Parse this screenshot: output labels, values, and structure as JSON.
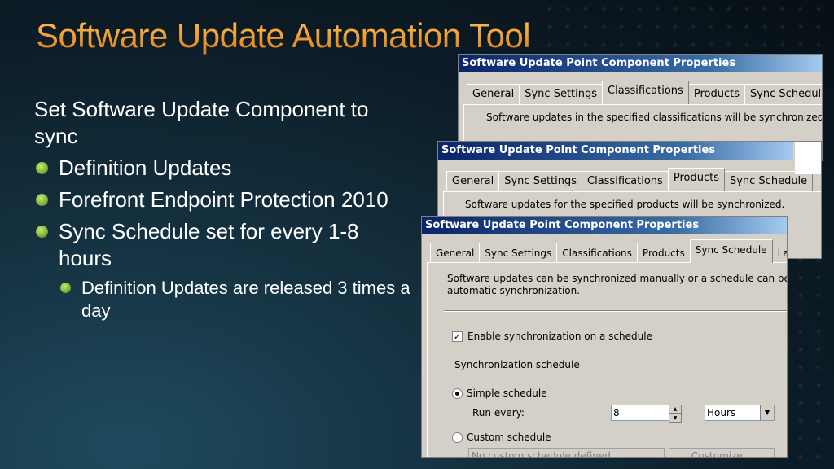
{
  "slide": {
    "title": "Software Update Automation Tool",
    "intro": "Set Software Update Component to sync",
    "bullets": [
      "Definition Updates",
      "Forefront Endpoint Protection 2010",
      "Sync Schedule set for every 1-8 hours"
    ],
    "sub_bullets": [
      "Definition Updates are released 3 times a day"
    ]
  },
  "dialog_back": {
    "title": "Software Update Point Component Properties",
    "tabs": [
      "General",
      "Sync Settings",
      "Classifications",
      "Products",
      "Sync Schedule"
    ],
    "active_tab": "Classifications",
    "description": "Software updates in the specified classifications will be synchronized"
  },
  "dialog_middle": {
    "title": "Software Update Point Component Properties",
    "tabs": [
      "General",
      "Sync Settings",
      "Classifications",
      "Products",
      "Sync Schedule"
    ],
    "active_tab": "Products",
    "description": "Software updates for the specified products will be synchronized."
  },
  "dialog_front": {
    "title": "Software Update Point Component Properties",
    "tabs": [
      "General",
      "Sync Settings",
      "Classifications",
      "Products",
      "Sync Schedule",
      "Language"
    ],
    "active_tab": "Sync Schedule",
    "description_line1": "Software updates can be synchronized manually or a schedule can be set for",
    "description_line2": "automatic synchronization.",
    "enable_label": "Enable synchronization on a schedule",
    "enable_checked": true,
    "group_title": "Synchronization schedule",
    "simple_label": "Simple schedule",
    "run_every_label": "Run every:",
    "run_every_value": "8",
    "unit_value": "Hours",
    "custom_label": "Custom schedule",
    "custom_value": "No custom schedule defined",
    "customize_label": "Customize..."
  }
}
